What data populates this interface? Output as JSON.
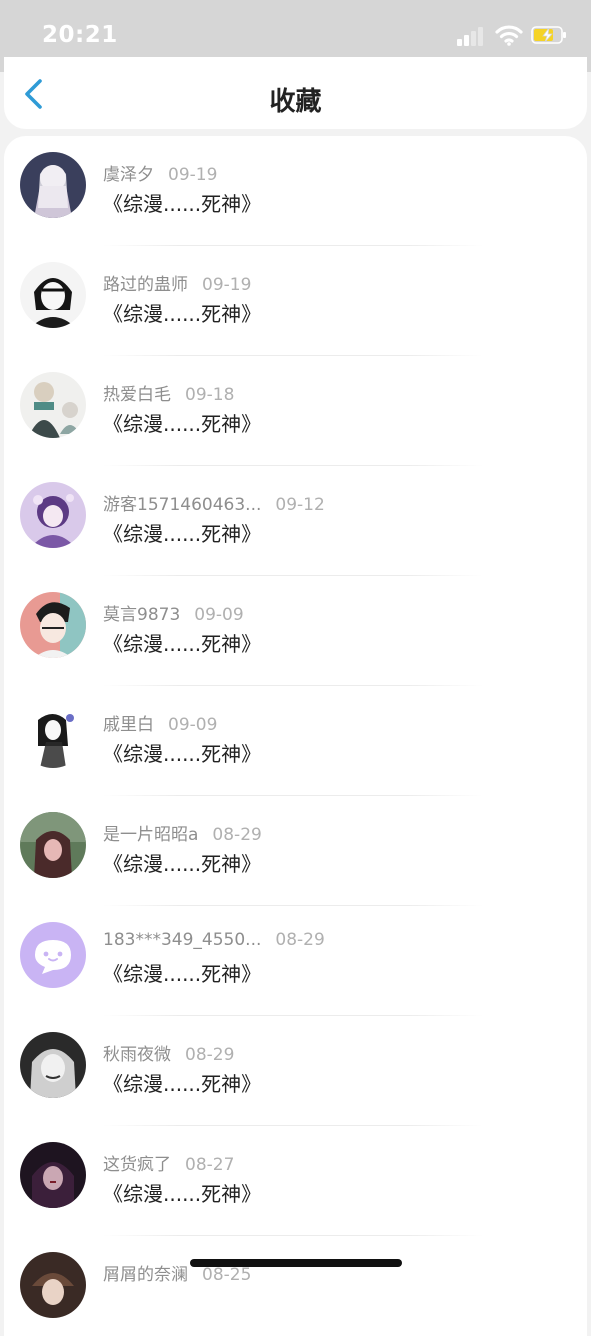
{
  "status_bar": {
    "time": "20:21"
  },
  "header": {
    "title": "收藏"
  },
  "items": [
    {
      "name": "虞泽夕",
      "date": "09-19",
      "title": "《综漫......死神》",
      "avatar": "avatar-icon"
    },
    {
      "name": "路过的蛊师",
      "date": "09-19",
      "title": "《综漫......死神》",
      "avatar": "avatar-icon"
    },
    {
      "name": "热爱白毛",
      "date": "09-18",
      "title": "《综漫......死神》",
      "avatar": "avatar-icon"
    },
    {
      "name": "游客1571460463...",
      "date": "09-12",
      "title": "《综漫......死神》",
      "avatar": "avatar-icon"
    },
    {
      "name": "莫言9873",
      "date": "09-09",
      "title": "《综漫......死神》",
      "avatar": "avatar-icon"
    },
    {
      "name": "戚里白",
      "date": "09-09",
      "title": "《综漫......死神》",
      "avatar": "avatar-icon"
    },
    {
      "name": "是一片昭昭a",
      "date": "08-29",
      "title": "《综漫......死神》",
      "avatar": "avatar-icon"
    },
    {
      "name": "183***349_4550...",
      "date": "08-29",
      "title": "《综漫......死神》",
      "avatar": "chat-bubble-icon"
    },
    {
      "name": "秋雨夜微",
      "date": "08-29",
      "title": "《综漫......死神》",
      "avatar": "avatar-icon"
    },
    {
      "name": "这货疯了",
      "date": "08-27",
      "title": "《综漫......死神》",
      "avatar": "avatar-icon"
    },
    {
      "name": "屑屑的奈澜",
      "date": "08-25",
      "title": "",
      "avatar": "avatar-icon"
    }
  ],
  "colors": {
    "accent": "#2f9bd6",
    "status_bar": "#d6d6d6",
    "battery": "#f5d327"
  }
}
